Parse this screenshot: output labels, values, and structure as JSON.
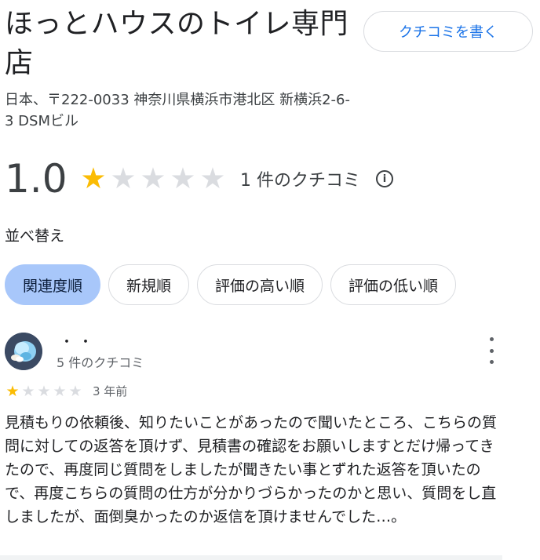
{
  "place": {
    "name": "ほっとハウスのトイレ専門店",
    "address": "日本、〒222-0033 神奈川県横浜市港北区 新横浜2-6-3 DSMビル"
  },
  "actions": {
    "write_review_label": "クチコミを書く"
  },
  "summary": {
    "score": "1.0",
    "rating": 1,
    "max_rating": 5,
    "review_count_text": "1 件のクチコミ",
    "info_icon": "info-icon"
  },
  "sort": {
    "label": "並べ替え",
    "options": [
      "関連度順",
      "新規順",
      "評価の高い順",
      "評価の低い順"
    ],
    "selected": "関連度順"
  },
  "reviews": [
    {
      "reviewer_name": "・・",
      "reviewer_meta": "5 件のクチコミ",
      "rating": 1,
      "max_rating": 5,
      "time_ago": "3 年前",
      "text": "見積もりの依頼後、知りたいことがあったので聞いたところ、こちらの質問に対しての返答を頂けず、見積書の確認をお願いしますとだけ帰ってきたので、再度同じ質問をしましたが聞きたい事とずれた返答を頂いたので、再度こちらの質問の仕方が分かりづらかったのかと思い、質問をし直しましたが、面倒臭かったのか返信を頂けませんでした…。"
    }
  ],
  "colors": {
    "star_filled": "#fbbc04",
    "star_empty": "#dadce0",
    "accent": "#1a73e8",
    "chip_selected": "#a8c7fa"
  }
}
